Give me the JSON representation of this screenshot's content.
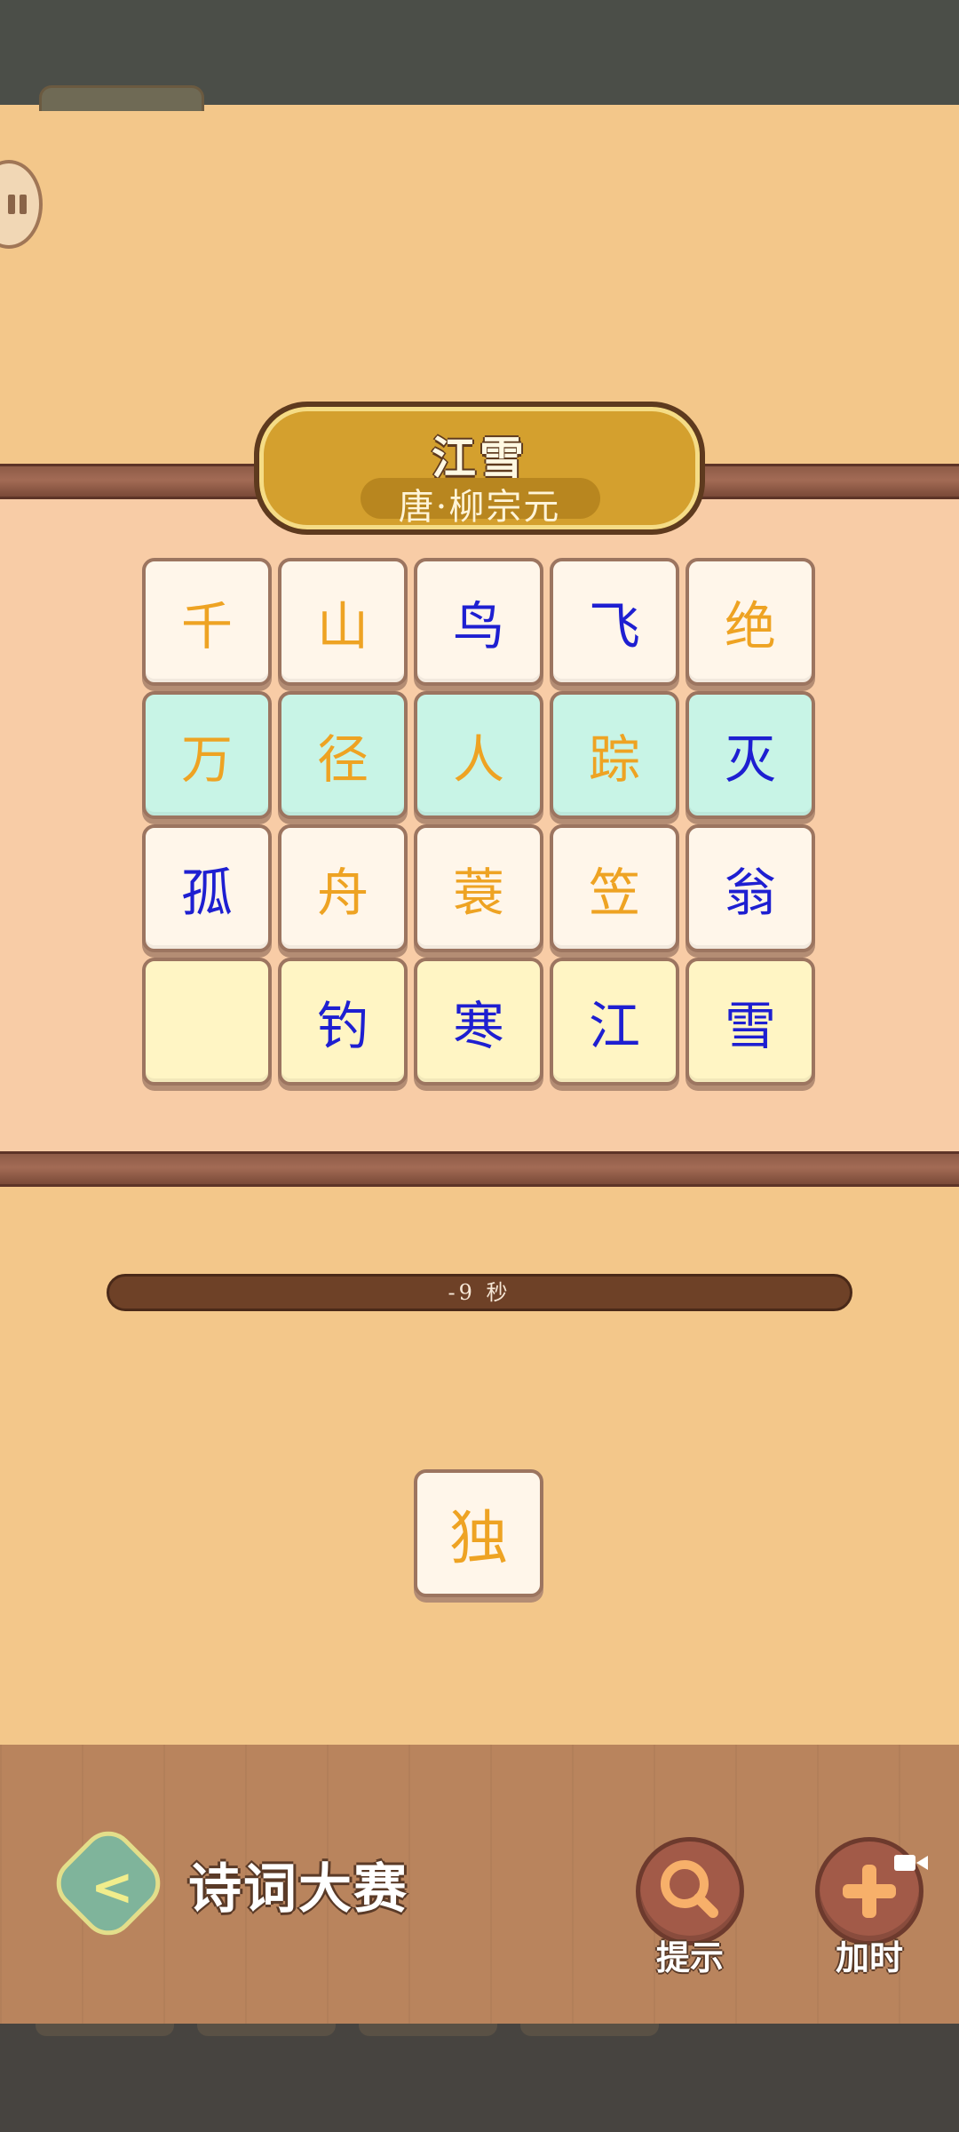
{
  "poem": {
    "title": "江雪",
    "author": "唐·柳宗元"
  },
  "board": {
    "rows": [
      [
        {
          "char": "千",
          "color": "orange",
          "bg": "white"
        },
        {
          "char": "山",
          "color": "orange",
          "bg": "white"
        },
        {
          "char": "鸟",
          "color": "blue",
          "bg": "white"
        },
        {
          "char": "飞",
          "color": "blue",
          "bg": "white"
        },
        {
          "char": "绝",
          "color": "orange",
          "bg": "white"
        }
      ],
      [
        {
          "char": "万",
          "color": "orange",
          "bg": "mint"
        },
        {
          "char": "径",
          "color": "orange",
          "bg": "mint"
        },
        {
          "char": "人",
          "color": "orange",
          "bg": "mint"
        },
        {
          "char": "踪",
          "color": "orange",
          "bg": "mint"
        },
        {
          "char": "灭",
          "color": "blue",
          "bg": "mint"
        }
      ],
      [
        {
          "char": "孤",
          "color": "blue",
          "bg": "white"
        },
        {
          "char": "舟",
          "color": "orange",
          "bg": "white"
        },
        {
          "char": "蓑",
          "color": "orange",
          "bg": "white"
        },
        {
          "char": "笠",
          "color": "orange",
          "bg": "white"
        },
        {
          "char": "翁",
          "color": "blue",
          "bg": "white"
        }
      ],
      [
        {
          "char": "",
          "color": "orange",
          "bg": "cream"
        },
        {
          "char": "钓",
          "color": "blue",
          "bg": "cream"
        },
        {
          "char": "寒",
          "color": "blue",
          "bg": "cream"
        },
        {
          "char": "江",
          "color": "blue",
          "bg": "cream"
        },
        {
          "char": "雪",
          "color": "blue",
          "bg": "cream"
        }
      ]
    ]
  },
  "timer": {
    "text": "-9 秒"
  },
  "pending_tile": {
    "char": "独"
  },
  "footer": {
    "game_title": "诗词大赛",
    "hint_label": "提示",
    "add_time_label": "加时"
  },
  "colors": {
    "orange": "#eea323",
    "blue": "#1e1fd1",
    "background": "#f3c78a",
    "board": "#f8cca6"
  },
  "icons": {
    "back": "chevron-left-icon",
    "hint": "magnifier-icon",
    "add_time": "plus-icon",
    "video": "video-camera-icon",
    "pause": "pause-icon"
  }
}
